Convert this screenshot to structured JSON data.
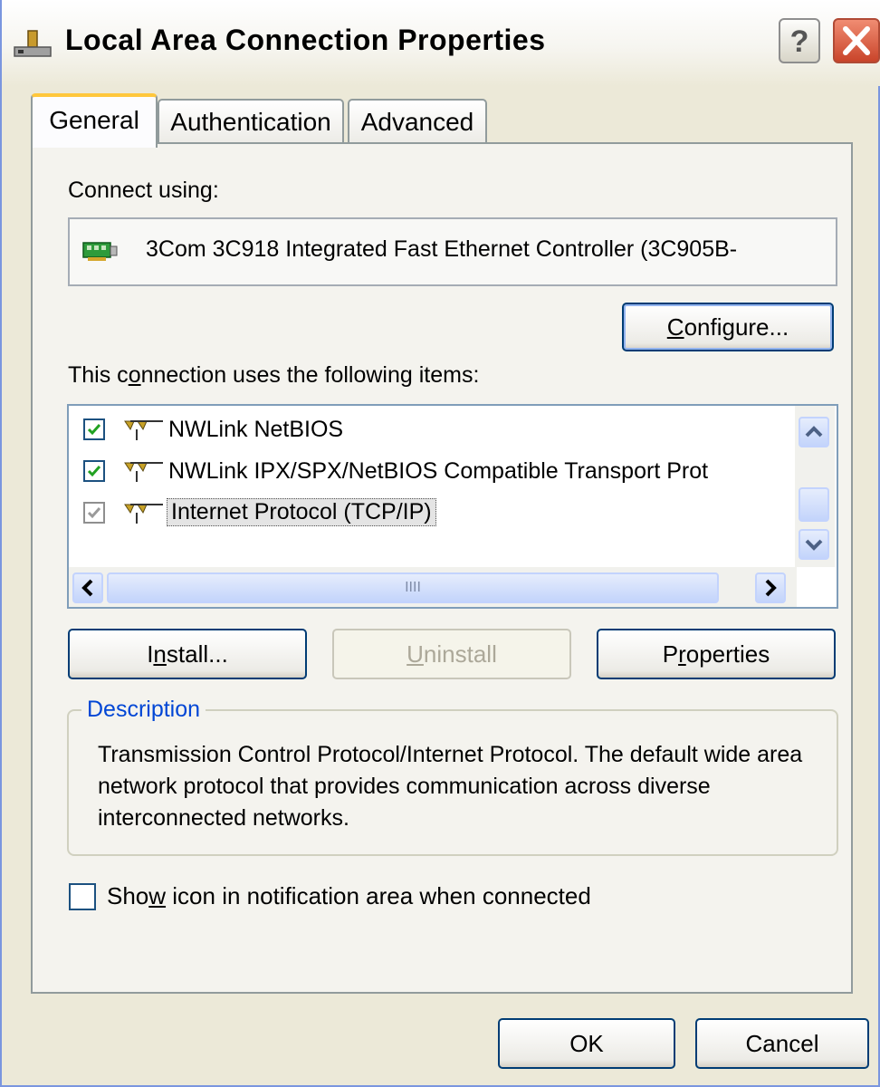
{
  "window": {
    "title": "Local Area Connection Properties",
    "help_symbol": "?",
    "close_symbol": "✕"
  },
  "tabs": [
    {
      "label": "General",
      "active": true
    },
    {
      "label": "Authentication",
      "active": false
    },
    {
      "label": "Advanced",
      "active": false
    }
  ],
  "general": {
    "connect_using_label": "Connect using:",
    "adapter_name": "3Com 3C918 Integrated Fast Ethernet Controller (3C905B-",
    "configure_button": {
      "pre": "",
      "accel": "C",
      "post": "onfigure..."
    },
    "items_label": {
      "pre": "This c",
      "accel": "o",
      "post": "nnection uses the following items:"
    },
    "items": [
      {
        "label": "NWLink NetBIOS",
        "checked": true,
        "selected": false
      },
      {
        "label": "NWLink IPX/SPX/NetBIOS Compatible Transport Prot",
        "checked": true,
        "selected": false
      },
      {
        "label": "Internet Protocol (TCP/IP)",
        "checked": true,
        "selected": true
      }
    ],
    "hscroll_grip": "IIII",
    "install_button": {
      "pre": "I",
      "accel": "n",
      "post": "stall..."
    },
    "uninstall_button": {
      "pre": "",
      "accel": "U",
      "post": "ninstall"
    },
    "properties_button": {
      "pre": "P",
      "accel": "r",
      "post": "operties"
    },
    "description_legend": "Description",
    "description_text": "Transmission Control Protocol/Internet Protocol. The default wide area network protocol that provides communication across diverse interconnected networks.",
    "show_icon_label": {
      "pre": "Sho",
      "accel": "w",
      "post": " icon in notification area when connected"
    },
    "show_icon_checked": false
  },
  "footer": {
    "ok_button": "OK",
    "cancel_button": "Cancel"
  },
  "colors": {
    "dialog_bg": "#ece9d8",
    "accent_blue": "#0046d5",
    "tab_highlight": "#ffc73c",
    "close_red": "#c9442a"
  }
}
